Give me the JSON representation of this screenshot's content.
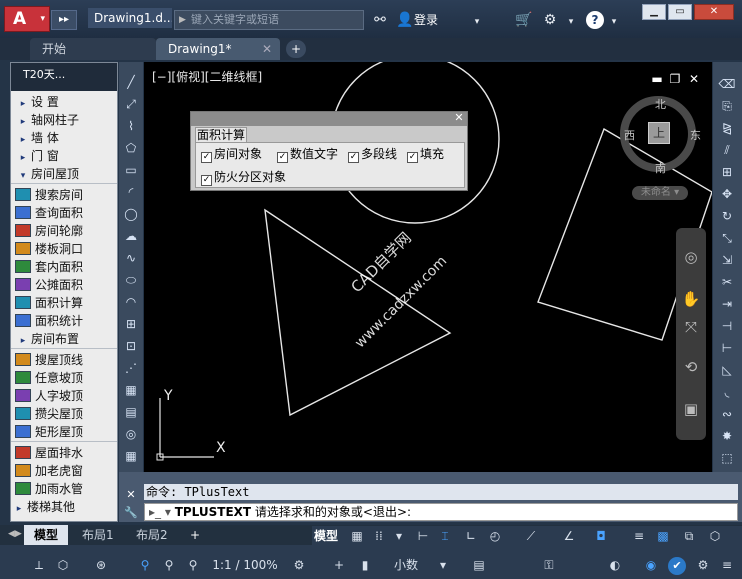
{
  "titlebar": {
    "app_letter": "A",
    "doc_title": "Drawing1.d...",
    "search_placeholder": "键入关键字或短语",
    "login_label": "登录",
    "help_label": "?"
  },
  "tabs": {
    "start": "开始",
    "drawing": "Drawing1*",
    "close": "✕",
    "add": "+"
  },
  "left_panel": {
    "title": "T20天...",
    "items": [
      {
        "label": "设  置",
        "kind": "arrow"
      },
      {
        "label": "轴网柱子",
        "kind": "arrow"
      },
      {
        "label": "墙  体",
        "kind": "arrow"
      },
      {
        "label": "门  窗",
        "kind": "arrow"
      },
      {
        "label": "房间屋顶",
        "kind": "open"
      },
      {
        "label": "搜索房间",
        "kind": "icon"
      },
      {
        "label": "查询面积",
        "kind": "icon"
      },
      {
        "label": "房间轮廓",
        "kind": "icon"
      },
      {
        "label": "楼板洞口",
        "kind": "icon"
      },
      {
        "label": "套内面积",
        "kind": "icon"
      },
      {
        "label": "公摊面积",
        "kind": "icon"
      },
      {
        "label": "面积计算",
        "kind": "icon"
      },
      {
        "label": "面积统计",
        "kind": "icon"
      },
      {
        "label": "房间布置",
        "kind": "arrow"
      },
      {
        "label": "搜屋顶线",
        "kind": "icon"
      },
      {
        "label": "任意坡顶",
        "kind": "icon"
      },
      {
        "label": "人字坡顶",
        "kind": "icon"
      },
      {
        "label": "攒尖屋顶",
        "kind": "icon"
      },
      {
        "label": "矩形屋顶",
        "kind": "icon"
      },
      {
        "label": "屋面排水",
        "kind": "icon"
      },
      {
        "label": "加老虎窗",
        "kind": "icon"
      },
      {
        "label": "加雨水管",
        "kind": "icon"
      },
      {
        "label": "楼梯其他",
        "kind": "arrow"
      }
    ]
  },
  "viewport": {
    "label": "[−][俯视][二维线框]",
    "compass": {
      "north": "北",
      "south": "南",
      "east": "东",
      "west": "西",
      "cube": "上"
    },
    "unnamed": "未命名 ▾"
  },
  "ucs": {
    "x": "X",
    "y": "Y"
  },
  "area_dialog": {
    "tab": "面积计算",
    "options": [
      {
        "label": "房间对象",
        "checked": true
      },
      {
        "label": "数值文字",
        "checked": true
      },
      {
        "label": "多段线",
        "checked": true
      },
      {
        "label": "填充",
        "checked": true
      },
      {
        "label": "防火分区对象",
        "checked": true
      }
    ]
  },
  "watermark": {
    "line1": "CAD自学网",
    "line2": "www.cadzxw.com"
  },
  "command": {
    "history": "命令: TPlusText",
    "prompt_cmd": "TPLUSTEXT",
    "prompt_text": " 请选择求和的对象或<退出>:"
  },
  "layout_tabs": {
    "model": "模型",
    "layout1": "布局1",
    "layout2": "布局2",
    "add": "+"
  },
  "statusbar": {
    "model_label": "模型",
    "scale": "1:1 / 100%",
    "unit": "小数"
  },
  "colors": {
    "canvas": "#000000",
    "app_red": "#c8323a",
    "dialog": "#c9c9c9"
  }
}
